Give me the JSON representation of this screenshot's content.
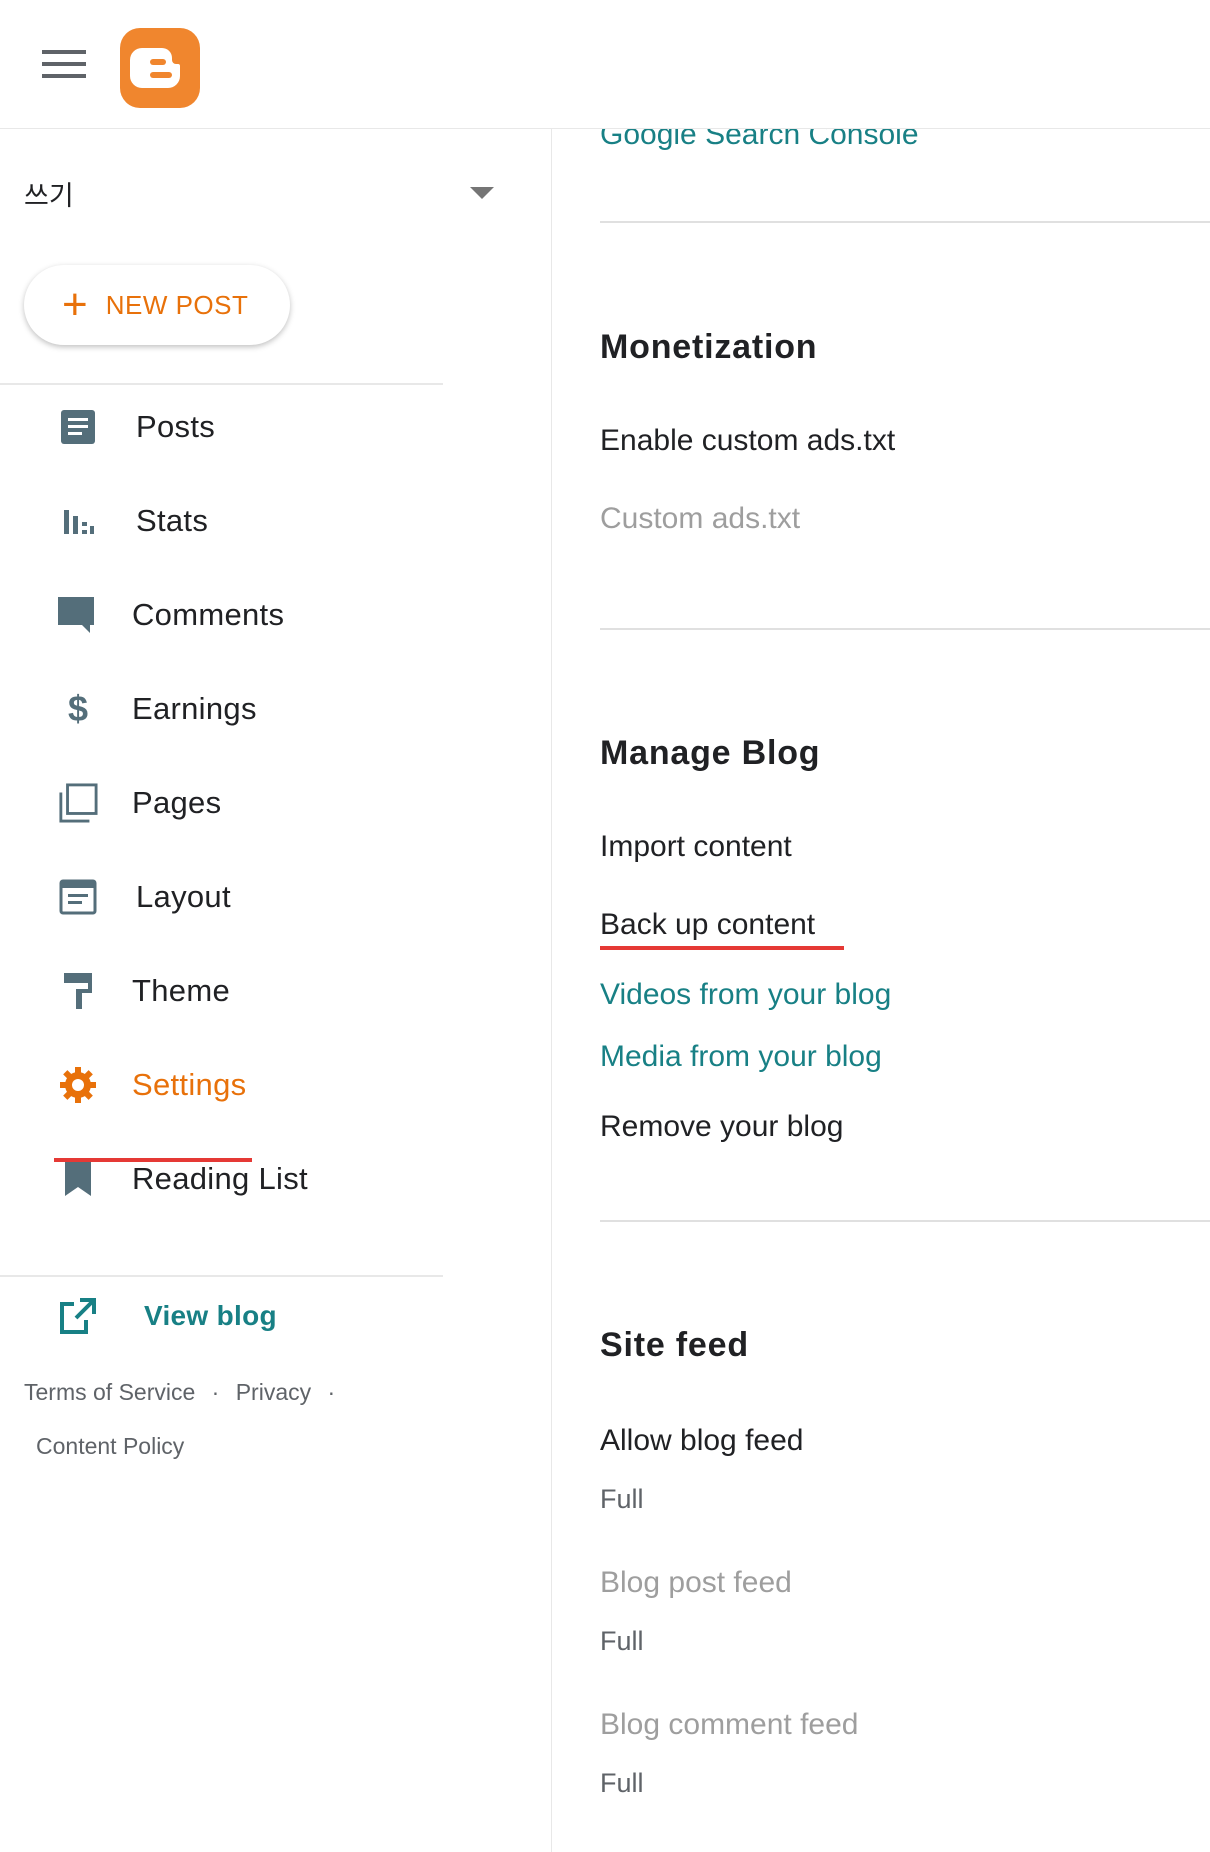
{
  "header": {
    "menu_icon": "hamburger-menu-icon",
    "logo_icon": "blogger-logo-icon",
    "brand_color": "#f0862e"
  },
  "sidebar": {
    "blog_name": "쓰기",
    "new_post_label": "NEW POST",
    "accent_color": "#e8710a",
    "items": [
      {
        "label": "Posts",
        "icon": "posts-icon"
      },
      {
        "label": "Stats",
        "icon": "stats-icon"
      },
      {
        "label": "Comments",
        "icon": "comments-icon"
      },
      {
        "label": "Earnings",
        "icon": "dollar-icon"
      },
      {
        "label": "Pages",
        "icon": "pages-icon"
      },
      {
        "label": "Layout",
        "icon": "layout-icon"
      },
      {
        "label": "Theme",
        "icon": "paint-roller-icon"
      },
      {
        "label": "Settings",
        "icon": "gear-icon",
        "active": true
      },
      {
        "label": "Reading List",
        "icon": "bookmark-icon"
      }
    ],
    "view_blog_label": "View blog",
    "footer": {
      "terms": "Terms of Service",
      "privacy": "Privacy",
      "content_policy": "Content Policy",
      "separator": "·"
    }
  },
  "main": {
    "google_search_console": "Google Search Console",
    "monetization": {
      "heading": "Monetization",
      "enable_ads_txt": "Enable custom ads.txt",
      "custom_ads_txt": "Custom ads.txt"
    },
    "manage_blog": {
      "heading": "Manage Blog",
      "import_content": "Import content",
      "back_up_content": "Back up content",
      "videos": "Videos from your blog",
      "media": "Media from your blog",
      "remove": "Remove your blog"
    },
    "site_feed": {
      "heading": "Site feed",
      "allow_blog_feed": "Allow blog feed",
      "allow_blog_feed_value": "Full",
      "blog_post_feed": "Blog post feed",
      "blog_post_feed_value": "Full",
      "blog_comment_feed": "Blog comment feed",
      "blog_comment_feed_value": "Full"
    },
    "link_color": "#188085"
  }
}
